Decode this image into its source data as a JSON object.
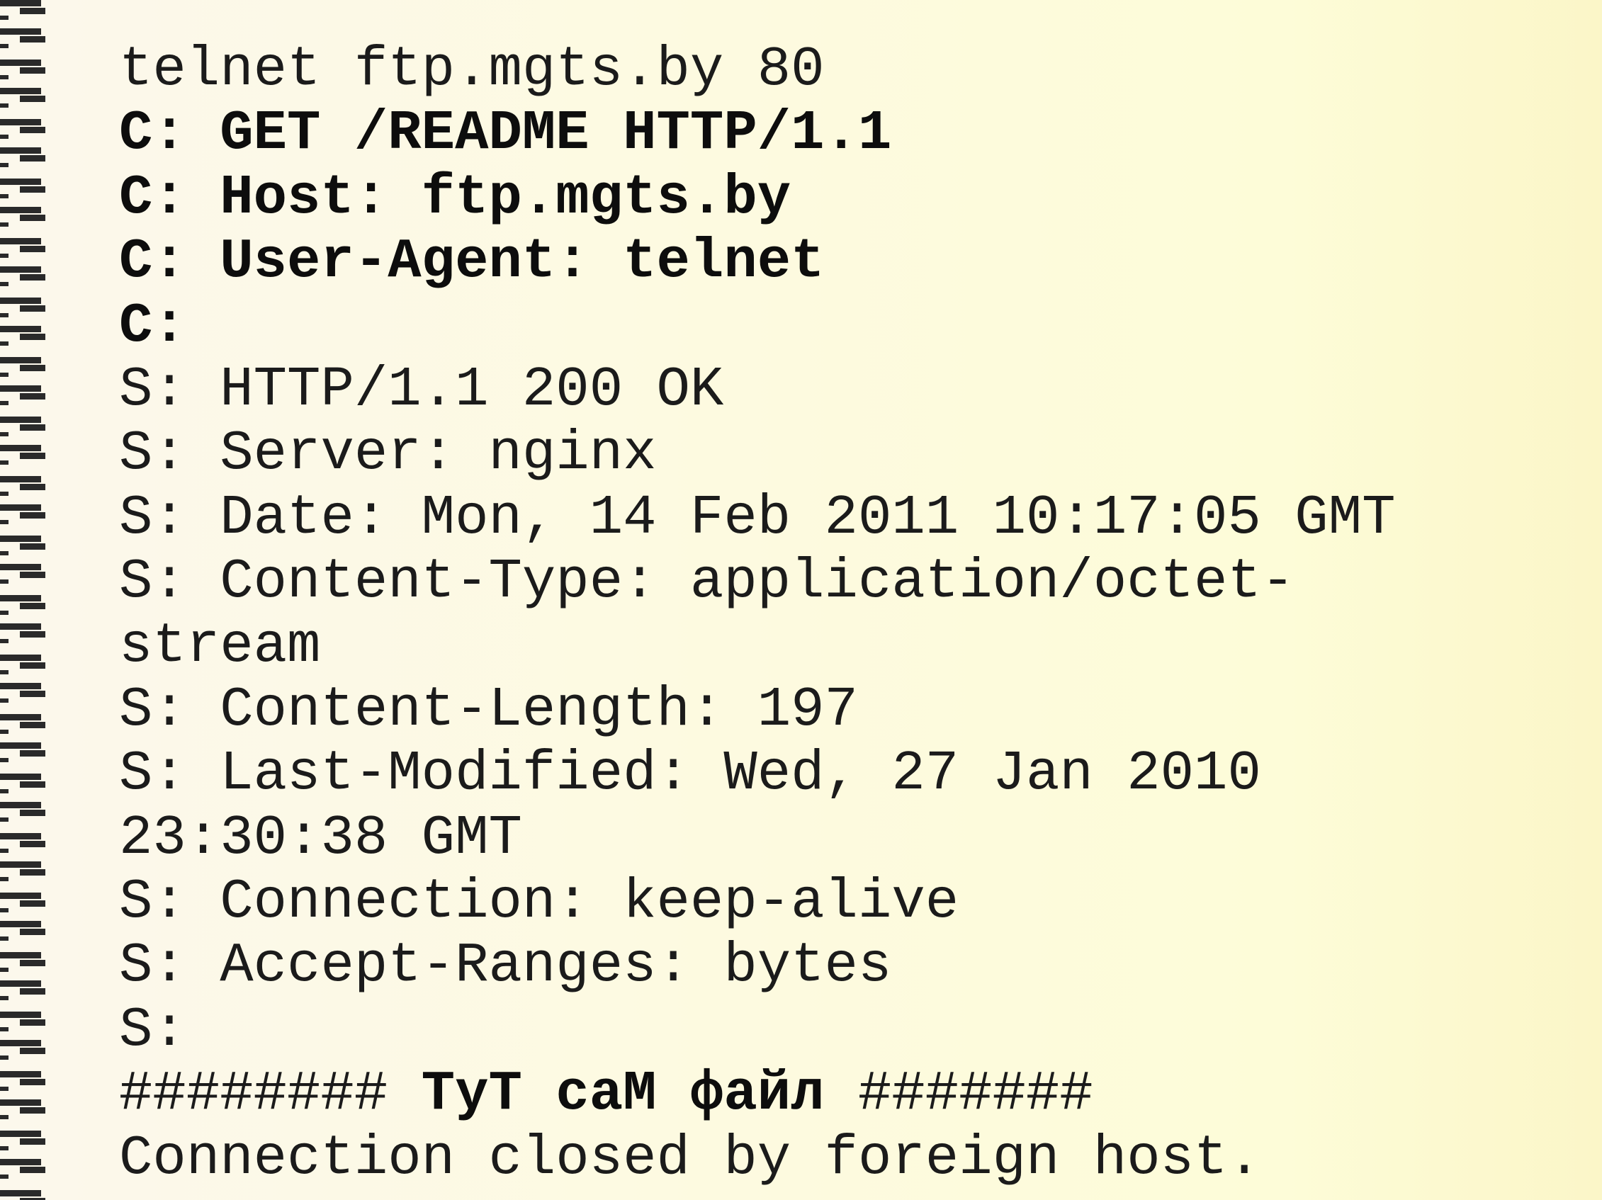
{
  "slide": {
    "lines": [
      {
        "style": "normal",
        "parts": [
          {
            "text": "telnet ftp.mgts.by 80",
            "bold": false
          }
        ]
      },
      {
        "style": "bold",
        "parts": [
          {
            "text": "C: GET /README HTTP/1.1",
            "bold": true
          }
        ]
      },
      {
        "style": "bold",
        "parts": [
          {
            "text": "C: Host: ftp.mgts.by",
            "bold": true
          }
        ]
      },
      {
        "style": "bold",
        "parts": [
          {
            "text": "C: User-Agent: telnet",
            "bold": true
          }
        ]
      },
      {
        "style": "bold",
        "parts": [
          {
            "text": "C:",
            "bold": true
          }
        ]
      },
      {
        "style": "normal",
        "parts": [
          {
            "text": "S: HTTP/1.1 200 OK",
            "bold": false
          }
        ]
      },
      {
        "style": "normal",
        "parts": [
          {
            "text": "S: Server: nginx",
            "bold": false
          }
        ]
      },
      {
        "style": "normal",
        "parts": [
          {
            "text": "S: Date: Mon, 14 Feb 2011 10:17:05 GMT",
            "bold": false
          }
        ]
      },
      {
        "style": "normal",
        "parts": [
          {
            "text": "S: Content-Type: application/octet-",
            "bold": false
          }
        ]
      },
      {
        "style": "normal",
        "parts": [
          {
            "text": "stream",
            "bold": false
          }
        ]
      },
      {
        "style": "normal",
        "parts": [
          {
            "text": "S: Content-Length: 197",
            "bold": false
          }
        ]
      },
      {
        "style": "normal",
        "parts": [
          {
            "text": "S: Last-Modified: Wed, 27 Jan 2010",
            "bold": false
          }
        ]
      },
      {
        "style": "normal",
        "parts": [
          {
            "text": "23:30:38 GMT",
            "bold": false
          }
        ]
      },
      {
        "style": "normal",
        "parts": [
          {
            "text": "S: Connection: keep-alive",
            "bold": false
          }
        ]
      },
      {
        "style": "normal",
        "parts": [
          {
            "text": "S: Accept-Ranges: bytes",
            "bold": false
          }
        ]
      },
      {
        "style": "normal",
        "parts": [
          {
            "text": "S:",
            "bold": false
          }
        ]
      },
      {
        "style": "mixed",
        "parts": [
          {
            "text": "######## ",
            "bold": false
          },
          {
            "text": "ТуТ саМ файл",
            "bold": true
          },
          {
            "text": " #######",
            "bold": false
          }
        ]
      },
      {
        "style": "normal",
        "parts": [
          {
            "text": "Connection closed by foreign host.",
            "bold": false
          }
        ]
      }
    ]
  },
  "colors": {
    "background_left": "#fcf8ec",
    "background_right": "#fbf6c8",
    "text": "#1b1b1b",
    "binding_wire": "#2a2a2a"
  }
}
